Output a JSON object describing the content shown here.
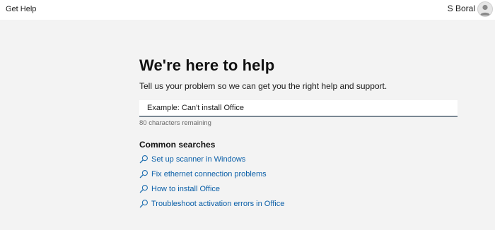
{
  "app": {
    "title": "Get Help"
  },
  "user": {
    "name": "S Boral",
    "avatar_icon": "person-icon"
  },
  "main": {
    "heading": "We're here to help",
    "subtitle": "Tell us your problem so we can get you the right help and support.",
    "search": {
      "placeholder": "Example: Can't install Office",
      "value": ""
    },
    "char_count": "80 characters remaining",
    "common_searches": {
      "title": "Common searches",
      "icon": "search-icon",
      "items": [
        {
          "label": "Set up scanner in Windows"
        },
        {
          "label": "Fix ethernet connection problems"
        },
        {
          "label": "How to install Office"
        },
        {
          "label": "Troubleshoot activation errors in Office"
        }
      ]
    }
  },
  "colors": {
    "background": "#f3f3f3",
    "titlebar": "#ffffff",
    "link": "#0a5fa8",
    "input_underline": "#7a8793"
  }
}
